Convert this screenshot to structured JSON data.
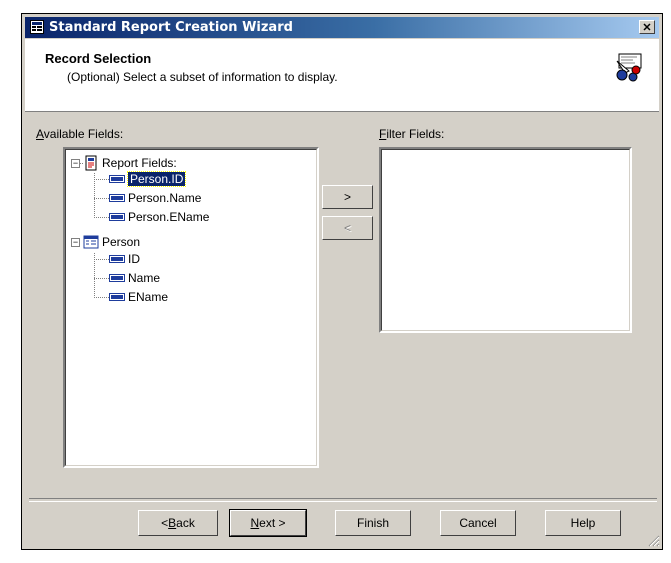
{
  "window": {
    "title": "Standard Report Creation Wizard",
    "close_label": "✕"
  },
  "header": {
    "title": "Record Selection",
    "subtitle": "(Optional)  Select a subset of information to display."
  },
  "available": {
    "label_prefix": "",
    "label_accel": "A",
    "label_rest": "vailable Fields:",
    "tree": [
      {
        "label": "Report Fields:",
        "icon": "report-icon",
        "expanded": true,
        "children": [
          "Person.ID",
          "Person.Name",
          "Person.EName"
        ],
        "selected_child": "Person.ID"
      },
      {
        "label": "Person",
        "icon": "table-icon",
        "expanded": true,
        "children": [
          "ID",
          "Name",
          "EName"
        ]
      }
    ],
    "expander_symbol": "−"
  },
  "filter": {
    "label_accel": "F",
    "label_rest": "ilter Fields:"
  },
  "transfer": {
    "add": ">",
    "remove": "<"
  },
  "footer": {
    "back_accel": "B",
    "back_pre": "< ",
    "back_rest": "ack",
    "next_accel": "N",
    "next_rest": "ext >",
    "finish": "Finish",
    "cancel": "Cancel",
    "help": "Help"
  }
}
